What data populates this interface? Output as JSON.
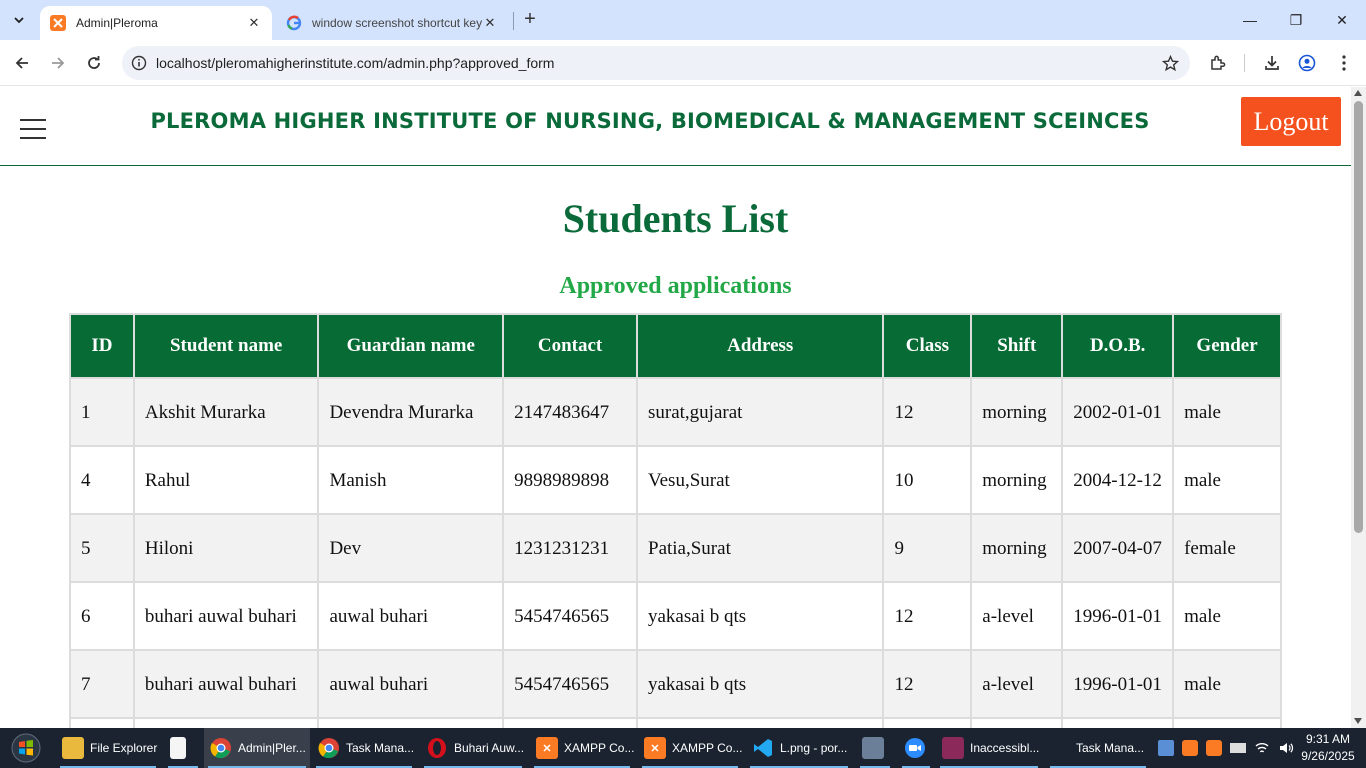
{
  "browser": {
    "tabs": [
      {
        "title": "Admin|Pleroma",
        "active": true
      },
      {
        "title": "window screenshot shortcut key",
        "active": false
      }
    ],
    "url_host": "localhost",
    "url_path": "/pleromahigherinstitute.com/admin.php?approved_form"
  },
  "header": {
    "title": "PLEROMA HIGHER INSTITUTE OF NURSING, BIOMEDICAL & MANAGEMENT SCEINCES",
    "logout_label": "Logout"
  },
  "page": {
    "heading": "Students List",
    "subheading": "Approved applications"
  },
  "table": {
    "headers": [
      "ID",
      "Student name",
      "Guardian name",
      "Contact",
      "Address",
      "Class",
      "Shift",
      "D.O.B.",
      "Gender"
    ],
    "rows": [
      [
        "1",
        "Akshit Murarka",
        "Devendra Murarka",
        "2147483647",
        "surat,gujarat",
        "12",
        "morning",
        "2002-01-01",
        "male"
      ],
      [
        "4",
        "Rahul",
        "Manish",
        "9898989898",
        "Vesu,Surat",
        "10",
        "morning",
        "2004-12-12",
        "male"
      ],
      [
        "5",
        "Hiloni",
        "Dev",
        "1231231231",
        "Patia,Surat",
        "9",
        "morning",
        "2007-04-07",
        "female"
      ],
      [
        "6",
        "buhari auwal buhari",
        "auwal buhari",
        "5454746565",
        "yakasai b qts",
        "12",
        "a-level",
        "1996-01-01",
        "male"
      ],
      [
        "7",
        "buhari auwal buhari",
        "auwal buhari",
        "5454746565",
        "yakasai b qts",
        "12",
        "a-level",
        "1996-01-01",
        "male"
      ],
      [
        "",
        "",
        "",
        "",
        "",
        "",
        "",
        "",
        ""
      ]
    ]
  },
  "taskbar": {
    "items": [
      {
        "label": "File Explorer",
        "icon": "folder-icon"
      },
      {
        "label": "",
        "icon": "notepad-icon"
      },
      {
        "label": "Admin|Pler...",
        "icon": "chrome-icon"
      },
      {
        "label": "Task Mana...",
        "icon": "chrome-icon"
      },
      {
        "label": "Buhari Auw...",
        "icon": "opera-icon"
      },
      {
        "label": "XAMPP Co...",
        "icon": "xampp-icon"
      },
      {
        "label": "XAMPP Co...",
        "icon": "xampp-icon"
      },
      {
        "label": "L.png - por...",
        "icon": "vscode-icon"
      },
      {
        "label": "",
        "icon": "network-tool-icon"
      },
      {
        "label": "",
        "icon": "zoom-icon"
      },
      {
        "label": "Inaccessibl...",
        "icon": "winrar-icon"
      },
      {
        "label": "Task Mana...",
        "icon": "task-manager-icon"
      }
    ],
    "time": "9:31 AM",
    "date": "9/26/2025"
  },
  "colors": {
    "brand_green": "#0a6a3a",
    "table_header": "#066b34",
    "subheading_green": "#22a846",
    "logout_orange": "#f4511e"
  }
}
